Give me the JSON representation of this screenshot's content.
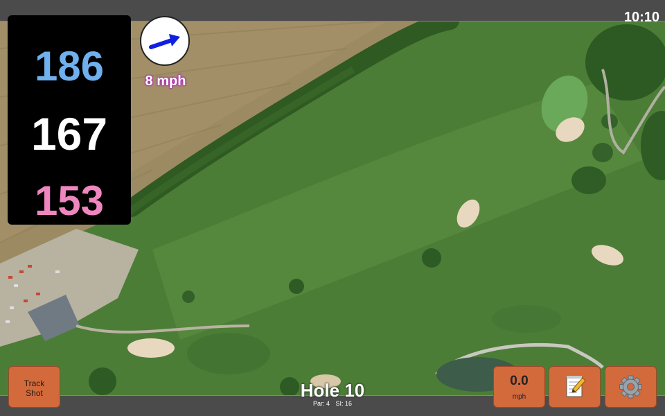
{
  "status": {
    "time": "10:10"
  },
  "distances": {
    "back": "186",
    "middle": "167",
    "front": "153"
  },
  "wind": {
    "speed_label": "8 mph"
  },
  "hole": {
    "title": "Hole 10",
    "par_label": "Par: 4",
    "si_label": "SI: 16"
  },
  "buttons": {
    "track_line1": "Track",
    "track_line2": "Shot",
    "speed_value": "0.0",
    "speed_unit": "mph"
  },
  "icons": {
    "wind": "wind-direction-arrow-icon",
    "notes": "notepad-pencil-icon",
    "settings": "gear-icon"
  },
  "colors": {
    "back_distance": "#6fb0ee",
    "middle_distance": "#ffffff",
    "front_distance": "#ef86c0",
    "button": "#d26a3c",
    "wind_arrow": "#1020e0",
    "divider": "#9a72a8"
  }
}
